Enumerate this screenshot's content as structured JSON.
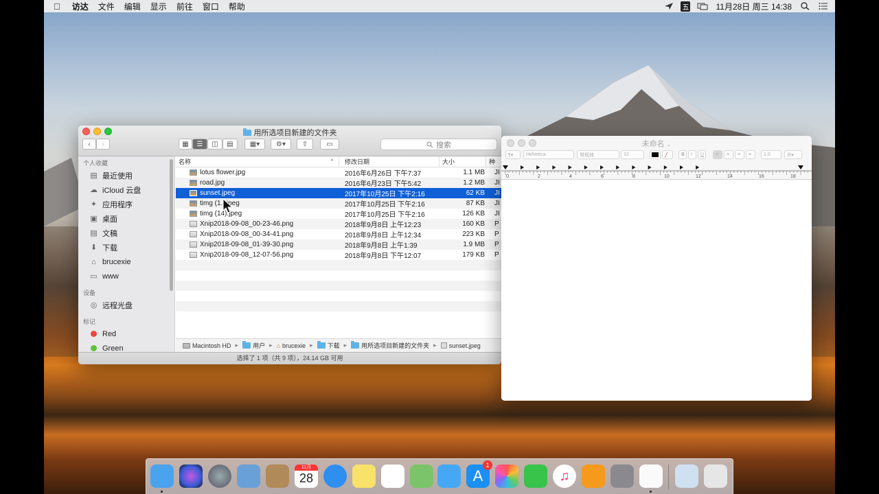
{
  "menubar": {
    "app": "访达",
    "items": [
      "文件",
      "编辑",
      "显示",
      "前往",
      "窗口",
      "帮助"
    ],
    "ime": "五",
    "clock": "11月28日 周三  14:38"
  },
  "finder": {
    "title": "用所选项目新建的文件夹",
    "search_placeholder": "搜索",
    "sidebar": {
      "favorites_header": "个人收藏",
      "favorites": [
        {
          "label": "最近使用",
          "icon": "recents-icon"
        },
        {
          "label": "iCloud 云盘",
          "icon": "cloud-icon"
        },
        {
          "label": "应用程序",
          "icon": "applications-icon"
        },
        {
          "label": "桌面",
          "icon": "desktop-icon"
        },
        {
          "label": "文稿",
          "icon": "documents-icon"
        },
        {
          "label": "下载",
          "icon": "downloads-icon"
        },
        {
          "label": "brucexie",
          "icon": "home-icon"
        },
        {
          "label": "www",
          "icon": "folder-icon"
        }
      ],
      "devices_header": "设备",
      "devices": [
        {
          "label": "远程光盘",
          "icon": "disc-icon"
        }
      ],
      "tags_header": "标记",
      "tags": [
        {
          "label": "Red",
          "color": "#e8463d"
        },
        {
          "label": "Green",
          "color": "#5cc23a"
        }
      ]
    },
    "columns": {
      "name": "名称",
      "date": "修改日期",
      "size": "大小",
      "kind": "种"
    },
    "files": [
      {
        "name": "lotus flower.jpg",
        "date": "2016年6月26日 下午7:37",
        "size": "1.1 MB",
        "kind": "JI",
        "type": "jpg"
      },
      {
        "name": "road.jpg",
        "date": "2016年6月23日 下午5:42",
        "size": "1.2 MB",
        "kind": "JI",
        "type": "jpg"
      },
      {
        "name": "sunset.jpeg",
        "date": "2017年10月25日 下午2:16",
        "size": "62 KB",
        "kind": "JI",
        "type": "jpg",
        "selected": true
      },
      {
        "name": "timg (1...jpeg",
        "date": "2017年10月25日 下午2:16",
        "size": "87 KB",
        "kind": "JI",
        "type": "jpg"
      },
      {
        "name": "timg (14).jpeg",
        "date": "2017年10月25日 下午2:16",
        "size": "126 KB",
        "kind": "JI",
        "type": "jpg"
      },
      {
        "name": "Xnip2018-09-08_00-23-46.png",
        "date": "2018年9月8日 上午12:23",
        "size": "160 KB",
        "kind": "P",
        "type": "png"
      },
      {
        "name": "Xnip2018-09-08_00-34-41.png",
        "date": "2018年9月8日 上午12:34",
        "size": "223 KB",
        "kind": "P",
        "type": "png"
      },
      {
        "name": "Xnip2018-09-08_01-39-30.png",
        "date": "2018年9月8日 上午1:39",
        "size": "1.9 MB",
        "kind": "P",
        "type": "png"
      },
      {
        "name": "Xnip2018-09-08_12-07-56.png",
        "date": "2018年9月8日 下午12:07",
        "size": "179 KB",
        "kind": "P",
        "type": "png"
      }
    ],
    "path": [
      "Macintosh HD",
      "用户",
      "brucexie",
      "下载",
      "用所选项目新建的文件夹",
      "sunset.jpeg"
    ],
    "status": "选择了 1 项（共 9 项），24.14 GB 可用"
  },
  "textedit": {
    "title": "未命名",
    "font": "Helvetica",
    "style": "常规体",
    "size": "12",
    "spacing": "1.0",
    "ruler_labels": [
      "0",
      "2",
      "4",
      "6",
      "8",
      "10",
      "12",
      "14",
      "16",
      "18"
    ]
  },
  "dock": {
    "calendar_month": "11月",
    "calendar_day": "28",
    "appstore_badge": "1",
    "apps": [
      "finder-icon",
      "siri-icon",
      "launchpad-icon",
      "preview-icon",
      "contacts-icon",
      "calendar-icon",
      "safari-icon",
      "notes-icon",
      "reminders-icon",
      "maps-icon",
      "messages-icon",
      "appstore-icon",
      "photos-icon",
      "facetime-icon",
      "itunes-icon",
      "books-icon",
      "system-preferences-icon",
      "textedit-icon",
      "downloads-stack-icon",
      "trash-icon"
    ]
  }
}
